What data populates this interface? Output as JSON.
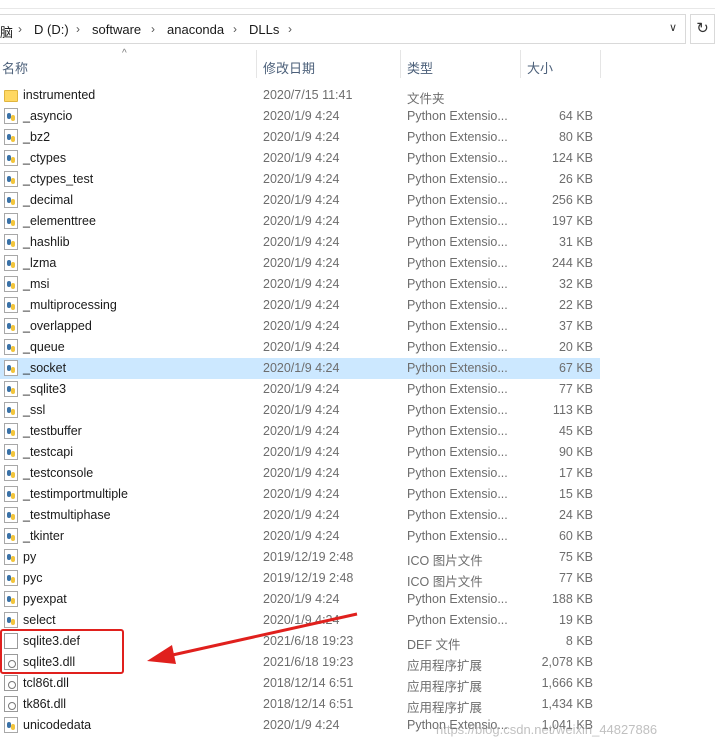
{
  "address": {
    "crumbs": [
      "脑",
      "D (D:)",
      "software",
      "anaconda",
      "DLLs"
    ],
    "dropdown_glyph": "∨",
    "refresh_glyph": "↻"
  },
  "header": {
    "name": "名称",
    "date": "修改日期",
    "type": "类型",
    "size": "大小",
    "sort_glyph": "^"
  },
  "files": [
    {
      "name": "instrumented",
      "date": "2020/7/15 11:41",
      "type": "文件夹",
      "size": "",
      "icon": "folder-icon"
    },
    {
      "name": "_asyncio",
      "date": "2020/1/9 4:24",
      "type": "Python Extensio...",
      "size": "64 KB",
      "icon": "python-file-icon"
    },
    {
      "name": "_bz2",
      "date": "2020/1/9 4:24",
      "type": "Python Extensio...",
      "size": "80 KB",
      "icon": "python-file-icon"
    },
    {
      "name": "_ctypes",
      "date": "2020/1/9 4:24",
      "type": "Python Extensio...",
      "size": "124 KB",
      "icon": "python-file-icon"
    },
    {
      "name": "_ctypes_test",
      "date": "2020/1/9 4:24",
      "type": "Python Extensio...",
      "size": "26 KB",
      "icon": "python-file-icon"
    },
    {
      "name": "_decimal",
      "date": "2020/1/9 4:24",
      "type": "Python Extensio...",
      "size": "256 KB",
      "icon": "python-file-icon"
    },
    {
      "name": "_elementtree",
      "date": "2020/1/9 4:24",
      "type": "Python Extensio...",
      "size": "197 KB",
      "icon": "python-file-icon"
    },
    {
      "name": "_hashlib",
      "date": "2020/1/9 4:24",
      "type": "Python Extensio...",
      "size": "31 KB",
      "icon": "python-file-icon"
    },
    {
      "name": "_lzma",
      "date": "2020/1/9 4:24",
      "type": "Python Extensio...",
      "size": "244 KB",
      "icon": "python-file-icon"
    },
    {
      "name": "_msi",
      "date": "2020/1/9 4:24",
      "type": "Python Extensio...",
      "size": "32 KB",
      "icon": "python-file-icon"
    },
    {
      "name": "_multiprocessing",
      "date": "2020/1/9 4:24",
      "type": "Python Extensio...",
      "size": "22 KB",
      "icon": "python-file-icon"
    },
    {
      "name": "_overlapped",
      "date": "2020/1/9 4:24",
      "type": "Python Extensio...",
      "size": "37 KB",
      "icon": "python-file-icon"
    },
    {
      "name": "_queue",
      "date": "2020/1/9 4:24",
      "type": "Python Extensio...",
      "size": "20 KB",
      "icon": "python-file-icon"
    },
    {
      "name": "_socket",
      "date": "2020/1/9 4:24",
      "type": "Python Extensio...",
      "size": "67 KB",
      "icon": "python-file-icon",
      "selected": true
    },
    {
      "name": "_sqlite3",
      "date": "2020/1/9 4:24",
      "type": "Python Extensio...",
      "size": "77 KB",
      "icon": "python-file-icon"
    },
    {
      "name": "_ssl",
      "date": "2020/1/9 4:24",
      "type": "Python Extensio...",
      "size": "113 KB",
      "icon": "python-file-icon"
    },
    {
      "name": "_testbuffer",
      "date": "2020/1/9 4:24",
      "type": "Python Extensio...",
      "size": "45 KB",
      "icon": "python-file-icon"
    },
    {
      "name": "_testcapi",
      "date": "2020/1/9 4:24",
      "type": "Python Extensio...",
      "size": "90 KB",
      "icon": "python-file-icon"
    },
    {
      "name": "_testconsole",
      "date": "2020/1/9 4:24",
      "type": "Python Extensio...",
      "size": "17 KB",
      "icon": "python-file-icon"
    },
    {
      "name": "_testimportmultiple",
      "date": "2020/1/9 4:24",
      "type": "Python Extensio...",
      "size": "15 KB",
      "icon": "python-file-icon"
    },
    {
      "name": "_testmultiphase",
      "date": "2020/1/9 4:24",
      "type": "Python Extensio...",
      "size": "24 KB",
      "icon": "python-file-icon"
    },
    {
      "name": "_tkinter",
      "date": "2020/1/9 4:24",
      "type": "Python Extensio...",
      "size": "60 KB",
      "icon": "python-file-icon"
    },
    {
      "name": "py",
      "date": "2019/12/19 2:48",
      "type": "ICO 图片文件",
      "size": "75 KB",
      "icon": "python-file-icon"
    },
    {
      "name": "pyc",
      "date": "2019/12/19 2:48",
      "type": "ICO 图片文件",
      "size": "77 KB",
      "icon": "python-file-icon"
    },
    {
      "name": "pyexpat",
      "date": "2020/1/9 4:24",
      "type": "Python Extensio...",
      "size": "188 KB",
      "icon": "python-file-icon"
    },
    {
      "name": "select",
      "date": "2020/1/9 4:24",
      "type": "Python Extensio...",
      "size": "19 KB",
      "icon": "python-file-icon"
    },
    {
      "name": "sqlite3.def",
      "date": "2021/6/18 19:23",
      "type": "DEF 文件",
      "size": "8 KB",
      "icon": "file-icon"
    },
    {
      "name": "sqlite3.dll",
      "date": "2021/6/18 19:23",
      "type": "应用程序扩展",
      "size": "2,078 KB",
      "icon": "dll-file-icon"
    },
    {
      "name": "tcl86t.dll",
      "date": "2018/12/14 6:51",
      "type": "应用程序扩展",
      "size": "1,666 KB",
      "icon": "dll-file-icon"
    },
    {
      "name": "tk86t.dll",
      "date": "2018/12/14 6:51",
      "type": "应用程序扩展",
      "size": "1,434 KB",
      "icon": "dll-file-icon"
    },
    {
      "name": "unicodedata",
      "date": "2020/1/9 4:24",
      "type": "Python Extensio...",
      "size": "1,041 KB",
      "icon": "python-file-icon"
    }
  ],
  "watermark": "https://blog.csdn.net/weixin_44827886",
  "colors": {
    "selected_row": "#cce8ff",
    "annotation": "#e0201d"
  }
}
